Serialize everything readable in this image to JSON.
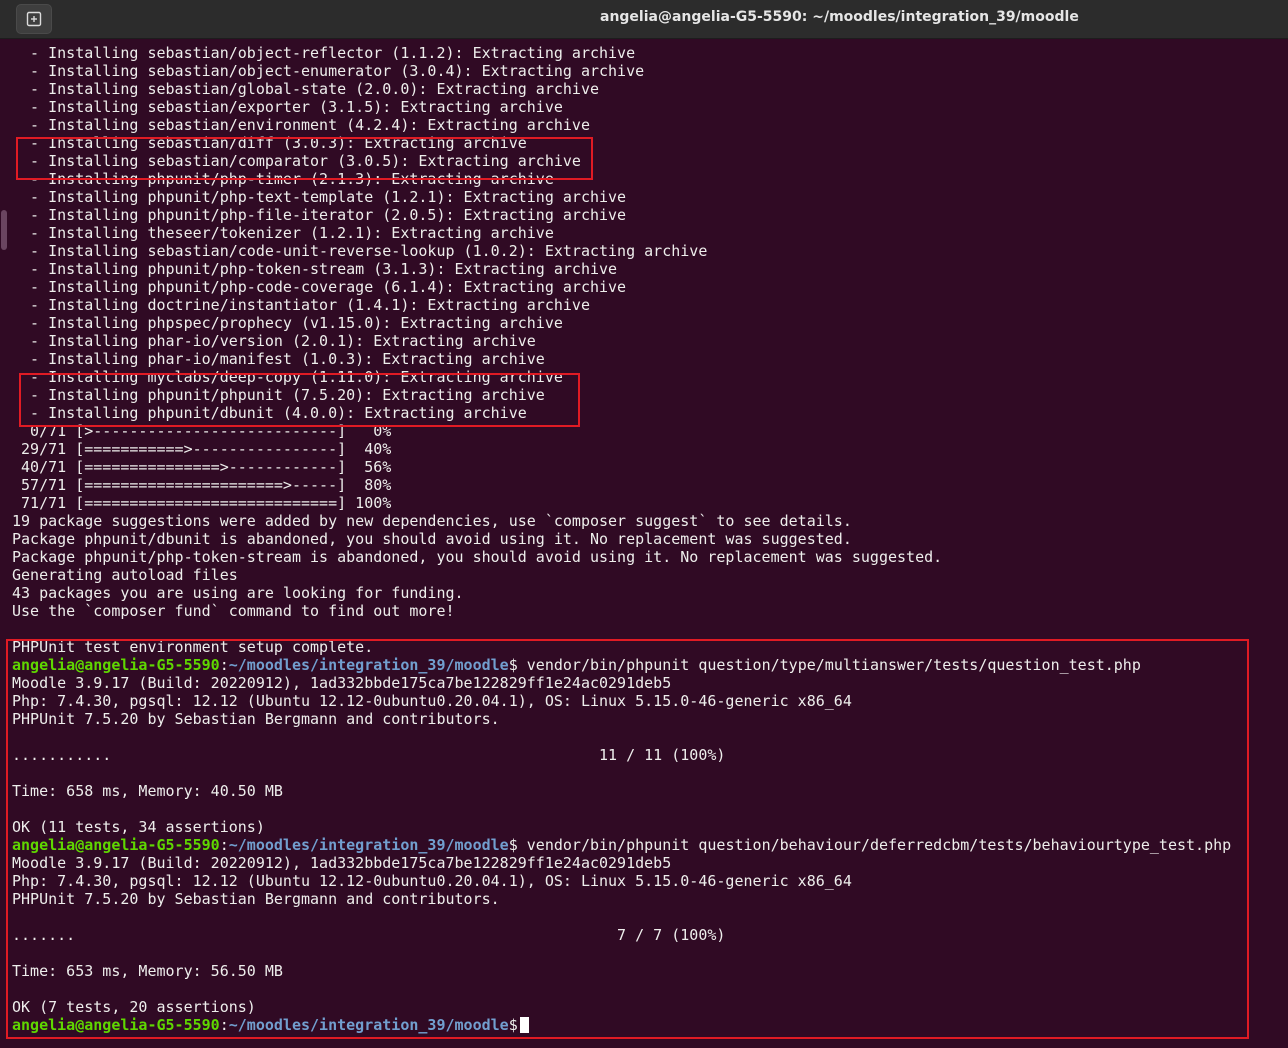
{
  "window": {
    "title": "angelia@angelia-G5-5590: ~/moodles/integration_39/moodle",
    "new_tab_icon": "new-tab-icon"
  },
  "prompt": {
    "user_host": "angelia@angelia-G5-5590",
    "path": "~/moodles/integration_39/moodle",
    "symbol": "$"
  },
  "install_lines": [
    "  - Installing sebastian/object-reflector (1.1.2): Extracting archive",
    "  - Installing sebastian/object-enumerator (3.0.4): Extracting archive",
    "  - Installing sebastian/global-state (2.0.0): Extracting archive",
    "  - Installing sebastian/exporter (3.1.5): Extracting archive",
    "  - Installing sebastian/environment (4.2.4): Extracting archive",
    "  - Installing sebastian/diff (3.0.3): Extracting archive",
    "  - Installing sebastian/comparator (3.0.5): Extracting archive",
    "  - Installing phpunit/php-timer (2.1.3): Extracting archive",
    "  - Installing phpunit/php-text-template (1.2.1): Extracting archive",
    "  - Installing phpunit/php-file-iterator (2.0.5): Extracting archive",
    "  - Installing theseer/tokenizer (1.2.1): Extracting archive",
    "  - Installing sebastian/code-unit-reverse-lookup (1.0.2): Extracting archive",
    "  - Installing phpunit/php-token-stream (3.1.3): Extracting archive",
    "  - Installing phpunit/php-code-coverage (6.1.4): Extracting archive",
    "  - Installing doctrine/instantiator (1.4.1): Extracting archive",
    "  - Installing phpspec/prophecy (v1.15.0): Extracting archive",
    "  - Installing phar-io/version (2.0.1): Extracting archive",
    "  - Installing phar-io/manifest (1.0.3): Extracting archive",
    "  - Installing myclabs/deep-copy (1.11.0): Extracting archive",
    "  - Installing phpunit/phpunit (7.5.20): Extracting archive",
    "  - Installing phpunit/dbunit (4.0.0): Extracting archive"
  ],
  "progress_lines": [
    "  0/71 [>---------------------------]   0%",
    " 29/71 [===========>----------------]  40%",
    " 40/71 [===============>------------]  56%",
    " 57/71 [======================>-----]  80%",
    " 71/71 [============================] 100%"
  ],
  "composer_lines": [
    "19 package suggestions were added by new dependencies, use `composer suggest` to see details.",
    "Package phpunit/dbunit is abandoned, you should avoid using it. No replacement was suggested.",
    "Package phpunit/php-token-stream is abandoned, you should avoid using it. No replacement was suggested.",
    "Generating autoload files",
    "43 packages you are using are looking for funding.",
    "Use the `composer fund` command to find out more!"
  ],
  "setup_complete": "PHPUnit test environment setup complete.",
  "run1": {
    "command": " vendor/bin/phpunit question/type/multianswer/tests/question_test.php",
    "moodle": "Moodle 3.9.17 (Build: 20220912), 1ad332bbde175ca7be122829ff1e24ac0291deb5",
    "php": "Php: 7.4.30, pgsql: 12.12 (Ubuntu 12.12-0ubuntu0.20.04.1), OS: Linux 5.15.0-46-generic x86_64",
    "phpunit": "PHPUnit 7.5.20 by Sebastian Bergmann and contributors.",
    "dots": "...........                                                      11 / 11 (100%)",
    "time": "Time: 658 ms, Memory: 40.50 MB",
    "result": "OK (11 tests, 34 assertions)"
  },
  "run2": {
    "command": " vendor/bin/phpunit question/behaviour/deferredcbm/tests/behaviourtype_test.php",
    "moodle": "Moodle 3.9.17 (Build: 20220912), 1ad332bbde175ca7be122829ff1e24ac0291deb5",
    "php": "Php: 7.4.30, pgsql: 12.12 (Ubuntu 12.12-0ubuntu0.20.04.1), OS: Linux 5.15.0-46-generic x86_64",
    "phpunit": "PHPUnit 7.5.20 by Sebastian Bergmann and contributors.",
    "dots": ".......                                                            7 / 7 (100%)",
    "time": "Time: 653 ms, Memory: 56.50 MB",
    "result": "OK (7 tests, 20 assertions)"
  },
  "colors": {
    "background": "#300a24",
    "text": "#eeeeec",
    "prompt_user": "#5fd700",
    "prompt_path": "#729fcf",
    "highlight_box": "#e01b24"
  }
}
